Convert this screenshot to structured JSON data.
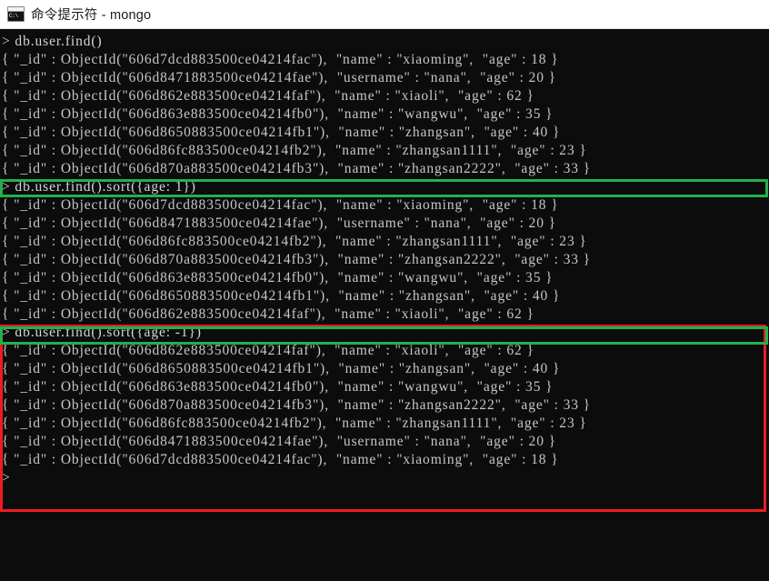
{
  "window": {
    "title": "命令提示符 - mongo",
    "icon": "cmd-prompt-icon",
    "icon_text": "C:\\",
    "titlebar_bg": "#ffffff",
    "console_bg": "#0c0c0c",
    "console_fg": "#c8c8c8"
  },
  "annotations": [
    {
      "name": "green-highlight-sort-asc",
      "color": "#22b14c",
      "target": "db.user.find().sort({age: 1})"
    },
    {
      "name": "red-highlight-sort-desc-block",
      "color": "#ed1c24",
      "target": "db.user.find().sort({age: -1}) output block"
    },
    {
      "name": "green-highlight-sort-desc",
      "color": "#22b14c",
      "target": "db.user.find().sort({age: -1})"
    }
  ],
  "terminal": {
    "prompt_symbol": ">",
    "lines": [
      {
        "type": "prompt",
        "text": "> db.user.find()"
      },
      {
        "type": "doc",
        "text": "{ \"_id\" : ObjectId(\"606d7dcd883500ce04214fac\"),  \"name\" : \"xiaoming\",  \"age\" : 18 }"
      },
      {
        "type": "doc",
        "text": "{ \"_id\" : ObjectId(\"606d8471883500ce04214fae\"),  \"username\" : \"nana\",  \"age\" : 20 }"
      },
      {
        "type": "doc",
        "text": "{ \"_id\" : ObjectId(\"606d862e883500ce04214faf\"),  \"name\" : \"xiaoli\",  \"age\" : 62 }"
      },
      {
        "type": "doc",
        "text": "{ \"_id\" : ObjectId(\"606d863e883500ce04214fb0\"),  \"name\" : \"wangwu\",  \"age\" : 35 }"
      },
      {
        "type": "doc",
        "text": "{ \"_id\" : ObjectId(\"606d8650883500ce04214fb1\"),  \"name\" : \"zhangsan\",  \"age\" : 40 }"
      },
      {
        "type": "doc",
        "text": "{ \"_id\" : ObjectId(\"606d86fc883500ce04214fb2\"),  \"name\" : \"zhangsan1111\",  \"age\" : 23 }"
      },
      {
        "type": "doc",
        "text": "{ \"_id\" : ObjectId(\"606d870a883500ce04214fb3\"),  \"name\" : \"zhangsan2222\",  \"age\" : 33 }"
      },
      {
        "type": "prompt",
        "text": "> db.user.find().sort({age: 1})"
      },
      {
        "type": "doc",
        "text": "{ \"_id\" : ObjectId(\"606d7dcd883500ce04214fac\"),  \"name\" : \"xiaoming\",  \"age\" : 18 }"
      },
      {
        "type": "doc",
        "text": "{ \"_id\" : ObjectId(\"606d8471883500ce04214fae\"),  \"username\" : \"nana\",  \"age\" : 20 }"
      },
      {
        "type": "doc",
        "text": "{ \"_id\" : ObjectId(\"606d86fc883500ce04214fb2\"),  \"name\" : \"zhangsan1111\",  \"age\" : 23 }"
      },
      {
        "type": "doc",
        "text": "{ \"_id\" : ObjectId(\"606d870a883500ce04214fb3\"),  \"name\" : \"zhangsan2222\",  \"age\" : 33 }"
      },
      {
        "type": "doc",
        "text": "{ \"_id\" : ObjectId(\"606d863e883500ce04214fb0\"),  \"name\" : \"wangwu\",  \"age\" : 35 }"
      },
      {
        "type": "doc",
        "text": "{ \"_id\" : ObjectId(\"606d8650883500ce04214fb1\"),  \"name\" : \"zhangsan\",  \"age\" : 40 }"
      },
      {
        "type": "doc",
        "text": "{ \"_id\" : ObjectId(\"606d862e883500ce04214faf\"),  \"name\" : \"xiaoli\",  \"age\" : 62 }"
      },
      {
        "type": "prompt",
        "text": "> db.user.find().sort({age: -1})"
      },
      {
        "type": "doc",
        "text": "{ \"_id\" : ObjectId(\"606d862e883500ce04214faf\"),  \"name\" : \"xiaoli\",  \"age\" : 62 }"
      },
      {
        "type": "doc",
        "text": "{ \"_id\" : ObjectId(\"606d8650883500ce04214fb1\"),  \"name\" : \"zhangsan\",  \"age\" : 40 }"
      },
      {
        "type": "doc",
        "text": "{ \"_id\" : ObjectId(\"606d863e883500ce04214fb0\"),  \"name\" : \"wangwu\",  \"age\" : 35 }"
      },
      {
        "type": "doc",
        "text": "{ \"_id\" : ObjectId(\"606d870a883500ce04214fb3\"),  \"name\" : \"zhangsan2222\",  \"age\" : 33 }"
      },
      {
        "type": "doc",
        "text": "{ \"_id\" : ObjectId(\"606d86fc883500ce04214fb2\"),  \"name\" : \"zhangsan1111\",  \"age\" : 23 }"
      },
      {
        "type": "doc",
        "text": "{ \"_id\" : ObjectId(\"606d8471883500ce04214fae\"),  \"username\" : \"nana\",  \"age\" : 20 }"
      },
      {
        "type": "doc",
        "text": "{ \"_id\" : ObjectId(\"606d7dcd883500ce04214fac\"),  \"name\" : \"xiaoming\",  \"age\" : 18 }"
      },
      {
        "type": "prompt",
        "text": ">"
      }
    ]
  }
}
